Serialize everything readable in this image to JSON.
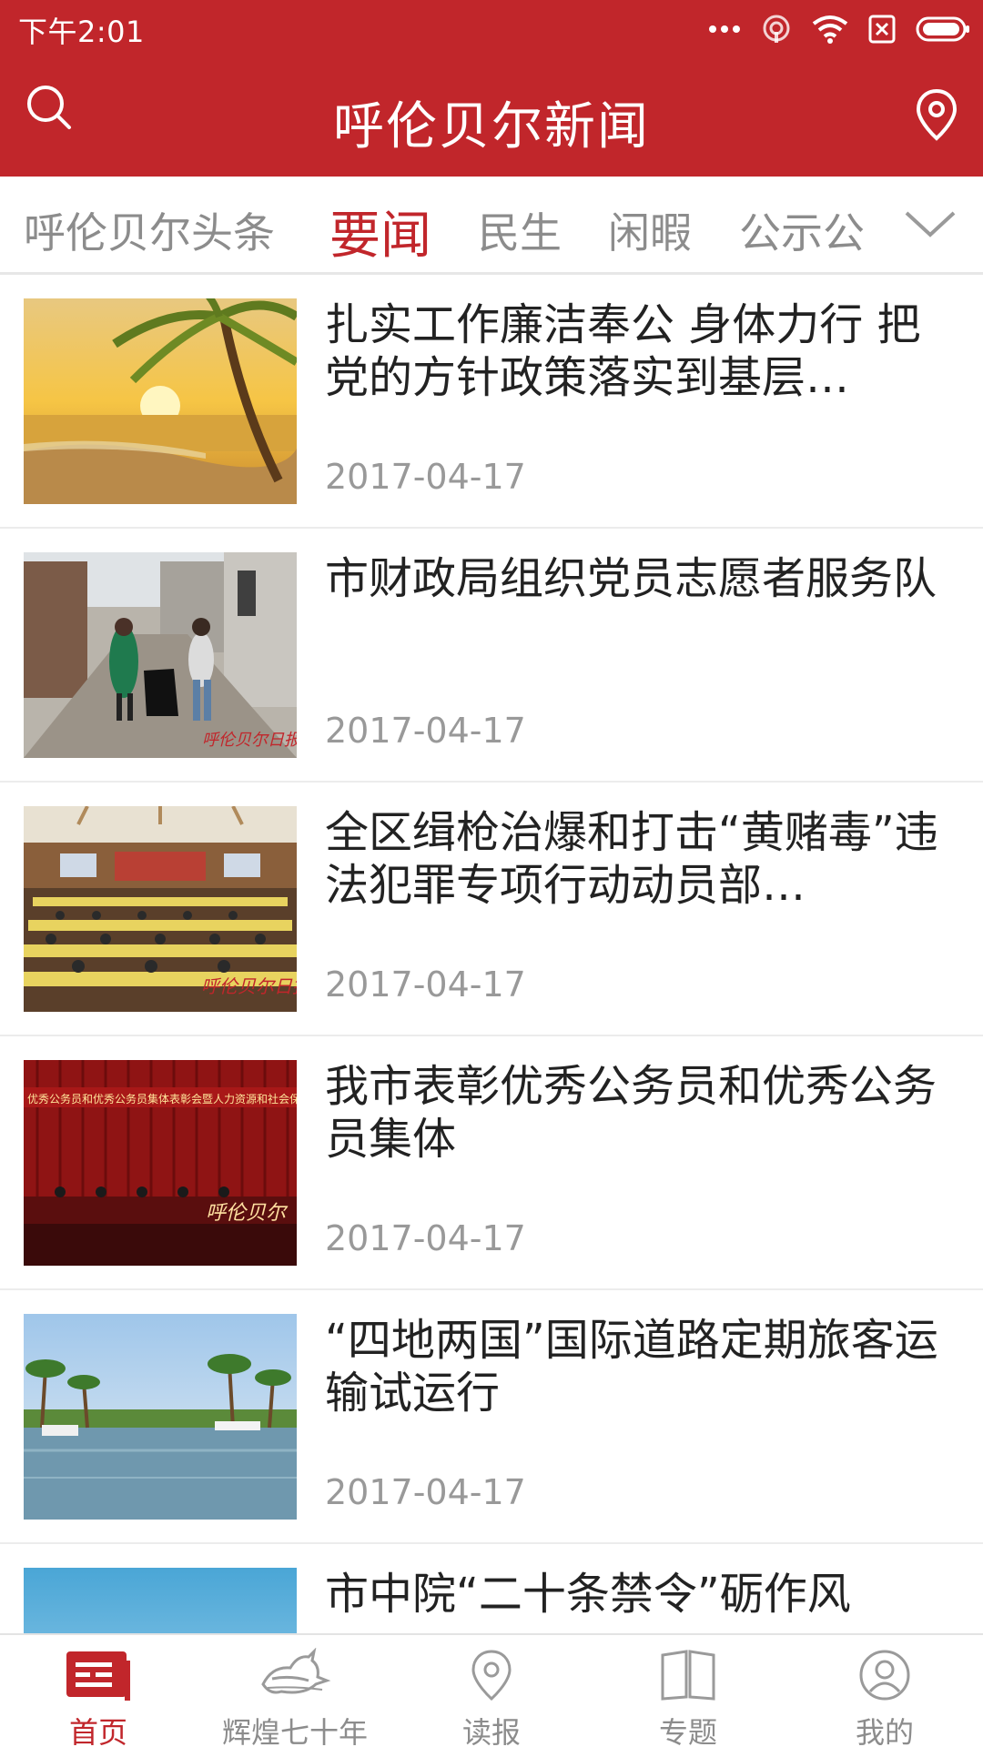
{
  "status_bar": {
    "time": "下午2:01"
  },
  "header": {
    "title": "呼伦贝尔新闻",
    "color": "#c1262b"
  },
  "tabs": [
    {
      "label": "呼伦贝尔头条",
      "active": false
    },
    {
      "label": "要闻",
      "active": true
    },
    {
      "label": "民生",
      "active": false
    },
    {
      "label": "闲暇",
      "active": false
    },
    {
      "label": "公示公",
      "active": false
    }
  ],
  "news": [
    {
      "title": "扎实工作廉洁奉公 身体力行 把党的方针政策落实到基层…",
      "date": "2017-04-17",
      "thumb_icon": "palm-beach-sunset-image"
    },
    {
      "title": "市财政局组织党员志愿者服务队",
      "date": "2017-04-17",
      "thumb_icon": "volunteers-alley-image",
      "watermark": "呼伦贝尔日报"
    },
    {
      "title": "全区缉枪治爆和打击“黄赌毒”违法犯罪专项行动动员部…",
      "date": "2017-04-17",
      "thumb_icon": "conference-hall-image",
      "watermark": "呼伦贝尔日报"
    },
    {
      "title": "我市表彰优秀公务员和优秀公务员集体",
      "date": "2017-04-17",
      "thumb_icon": "award-ceremony-stage-image",
      "watermark": "呼伦贝尔日报"
    },
    {
      "title": "“四地两国”国际道路定期旅客运输试运行",
      "date": "2017-04-17",
      "thumb_icon": "palm-waterway-image"
    },
    {
      "title": "市中院“二十条禁令”砺作风",
      "date": "",
      "thumb_icon": "sky-image"
    }
  ],
  "bottom_nav": [
    {
      "label": "首页",
      "icon": "home-news-icon",
      "active": true
    },
    {
      "label": "辉煌七十年",
      "icon": "horse-icon",
      "active": false
    },
    {
      "label": "读报",
      "icon": "location-pin-icon",
      "active": false
    },
    {
      "label": "专题",
      "icon": "open-book-icon",
      "active": false
    },
    {
      "label": "我的",
      "icon": "user-avatar-icon",
      "active": false
    }
  ]
}
